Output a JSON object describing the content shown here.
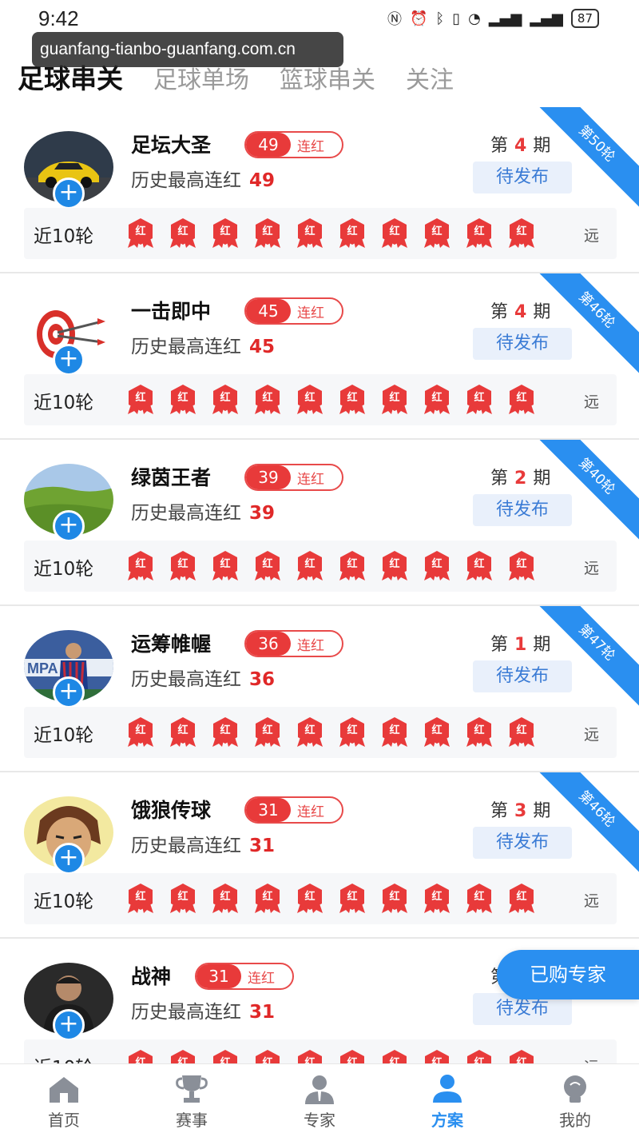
{
  "status_bar": {
    "time": "9:42",
    "icons": [
      "nfc-icon",
      "alarm-icon",
      "bluetooth-icon",
      "vibrate-icon",
      "wifi-icon",
      "signal-4g-icon",
      "signal-4g-icon"
    ],
    "battery": "87"
  },
  "url_overlay": "guanfang-tianbo-guanfang.com.cn",
  "tabs": [
    {
      "label": "足球串关",
      "active": true
    },
    {
      "label": "足球单场",
      "active": false
    },
    {
      "label": "篮球串关",
      "active": false
    },
    {
      "label": "关注",
      "active": false
    }
  ],
  "experts": [
    {
      "name": "足坛大圣",
      "streak": "49",
      "streak_label": "连红",
      "history_label": "历史最高连红",
      "history": "49",
      "issue_prefix": "第",
      "issue": "4",
      "issue_suffix": "期",
      "status": "待发布",
      "corner": "第50轮",
      "recent_label": "近10轮",
      "badges": [
        "红",
        "红",
        "红",
        "红",
        "红",
        "红",
        "红",
        "红",
        "红",
        "红"
      ],
      "far": "远",
      "avatar": "car"
    },
    {
      "name": "一击即中",
      "streak": "45",
      "streak_label": "连红",
      "history_label": "历史最高连红",
      "history": "45",
      "issue_prefix": "第",
      "issue": "4",
      "issue_suffix": "期",
      "status": "待发布",
      "corner": "第46轮",
      "recent_label": "近10轮",
      "badges": [
        "红",
        "红",
        "红",
        "红",
        "红",
        "红",
        "红",
        "红",
        "红",
        "红"
      ],
      "far": "远",
      "avatar": "target"
    },
    {
      "name": "绿茵王者",
      "streak": "39",
      "streak_label": "连红",
      "history_label": "历史最高连红",
      "history": "39",
      "issue_prefix": "第",
      "issue": "2",
      "issue_suffix": "期",
      "status": "待发布",
      "corner": "第40轮",
      "recent_label": "近10轮",
      "badges": [
        "红",
        "红",
        "红",
        "红",
        "红",
        "红",
        "红",
        "红",
        "红",
        "红"
      ],
      "far": "远",
      "avatar": "field"
    },
    {
      "name": "运筹帷幄",
      "streak": "36",
      "streak_label": "连红",
      "history_label": "历史最高连红",
      "history": "36",
      "issue_prefix": "第",
      "issue": "1",
      "issue_suffix": "期",
      "status": "待发布",
      "corner": "第47轮",
      "recent_label": "近10轮",
      "badges": [
        "红",
        "红",
        "红",
        "红",
        "红",
        "红",
        "红",
        "红",
        "红",
        "红"
      ],
      "far": "远",
      "avatar": "player"
    },
    {
      "name": "饿狼传球",
      "streak": "31",
      "streak_label": "连红",
      "history_label": "历史最高连红",
      "history": "31",
      "issue_prefix": "第",
      "issue": "3",
      "issue_suffix": "期",
      "status": "待发布",
      "corner": "第46轮",
      "recent_label": "近10轮",
      "badges": [
        "红",
        "红",
        "红",
        "红",
        "红",
        "红",
        "红",
        "红",
        "红",
        "红"
      ],
      "far": "远",
      "avatar": "fighter"
    },
    {
      "name": "战神",
      "streak": "31",
      "streak_label": "连红",
      "history_label": "历史最高连红",
      "history": "31",
      "issue_prefix": "第",
      "issue": "",
      "issue_suffix": "",
      "status": "待发布",
      "corner": "",
      "recent_label": "近10轮",
      "badges": [
        "红",
        "红",
        "红",
        "红",
        "红",
        "红",
        "红",
        "红",
        "红",
        "红"
      ],
      "far": "远",
      "avatar": "man"
    }
  ],
  "purchased_button": "已购专家",
  "bottom_nav": [
    {
      "label": "首页",
      "icon": "home-icon",
      "active": false
    },
    {
      "label": "赛事",
      "icon": "trophy-icon",
      "active": false
    },
    {
      "label": "专家",
      "icon": "expert-icon",
      "active": false
    },
    {
      "label": "方案",
      "icon": "plan-icon",
      "active": true
    },
    {
      "label": "我的",
      "icon": "profile-icon",
      "active": false
    }
  ],
  "colors": {
    "accent": "#2a8ff0",
    "red": "#e83a3a",
    "pending_bg": "#e9f0fb"
  }
}
